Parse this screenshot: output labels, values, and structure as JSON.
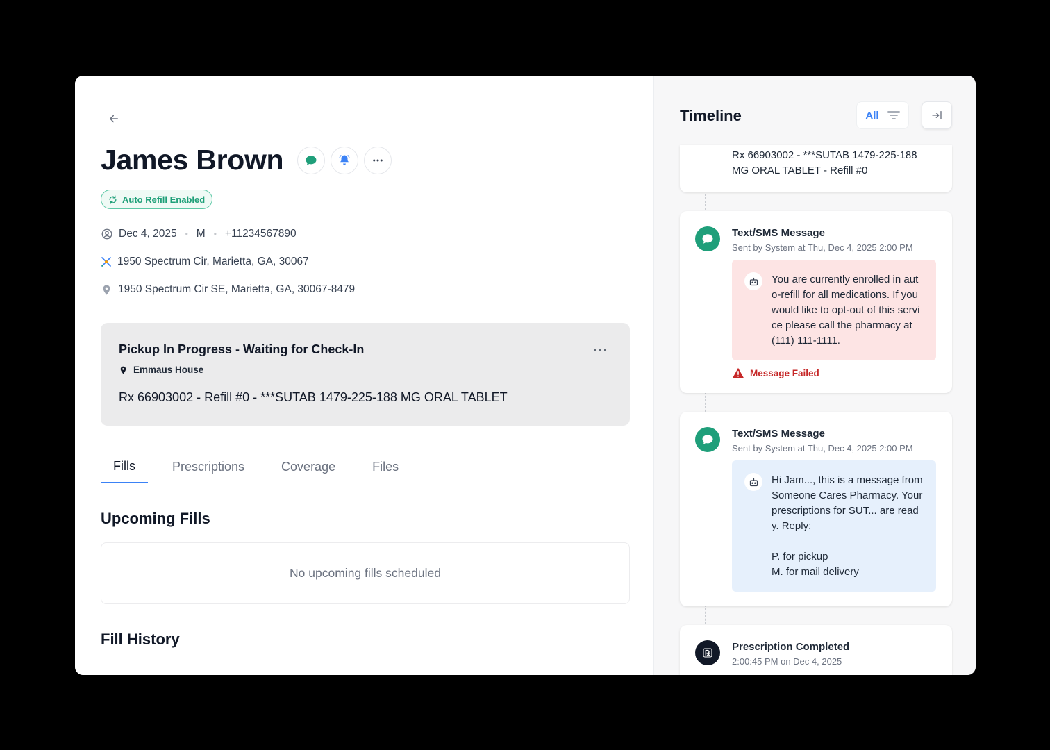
{
  "patient": {
    "name": "James Brown",
    "badge": "Auto Refill Enabled",
    "dob": "Dec 4, 2025",
    "sex": "M",
    "phone": "+11234567890",
    "address_shipping": "1950 Spectrum Cir, Marietta, GA, 30067",
    "address_home": "1950 Spectrum Cir SE, Marietta, GA, 30067-8479"
  },
  "status_card": {
    "title": "Pickup In Progress - Waiting for Check-In",
    "location": "Emmaus House",
    "rx": "Rx 66903002 - Refill #0 - ***SUTAB 1479-225-188 MG ORAL TABLET",
    "more": "···"
  },
  "tabs": [
    {
      "label": "Fills",
      "active": true
    },
    {
      "label": "Prescriptions",
      "active": false
    },
    {
      "label": "Coverage",
      "active": false
    },
    {
      "label": "Files",
      "active": false
    }
  ],
  "upcoming": {
    "title": "Upcoming Fills",
    "empty_text": "No upcoming fills scheduled"
  },
  "history": {
    "title": "Fill History"
  },
  "timeline": {
    "title": "Timeline",
    "filter_label": "All",
    "items": [
      {
        "text": "Rx 66903002 - ***SUTAB 1479-225-188 MG ORAL TABLET - Refill #0"
      },
      {
        "title": "Text/SMS Message",
        "subtitle": "Sent by System at Thu, Dec 4, 2025 2:00 PM",
        "message": "You are currently enrolled in auto-refill for all medications. If you would like to opt-out of this service please call the pharmacy at (111) 111-1111.",
        "status": "Message Failed"
      },
      {
        "title": "Text/SMS Message",
        "subtitle": "Sent by System at Thu, Dec 4, 2025 2:00 PM",
        "message": "Hi Jam..., this is a message from Someone Cares Pharmacy. Your prescriptions for SUT... are ready. Reply:\n\nP. for pickup\nM. for mail delivery"
      },
      {
        "title": "Prescription Completed",
        "subtitle": "2:00:45 PM on Dec 4, 2025"
      }
    ]
  },
  "colors": {
    "accent": "#3b82f6",
    "green": "#1f9f7a",
    "error": "#c62828",
    "failed_bubble": "#fde4e4",
    "info_bubble": "#e6f0fc"
  }
}
